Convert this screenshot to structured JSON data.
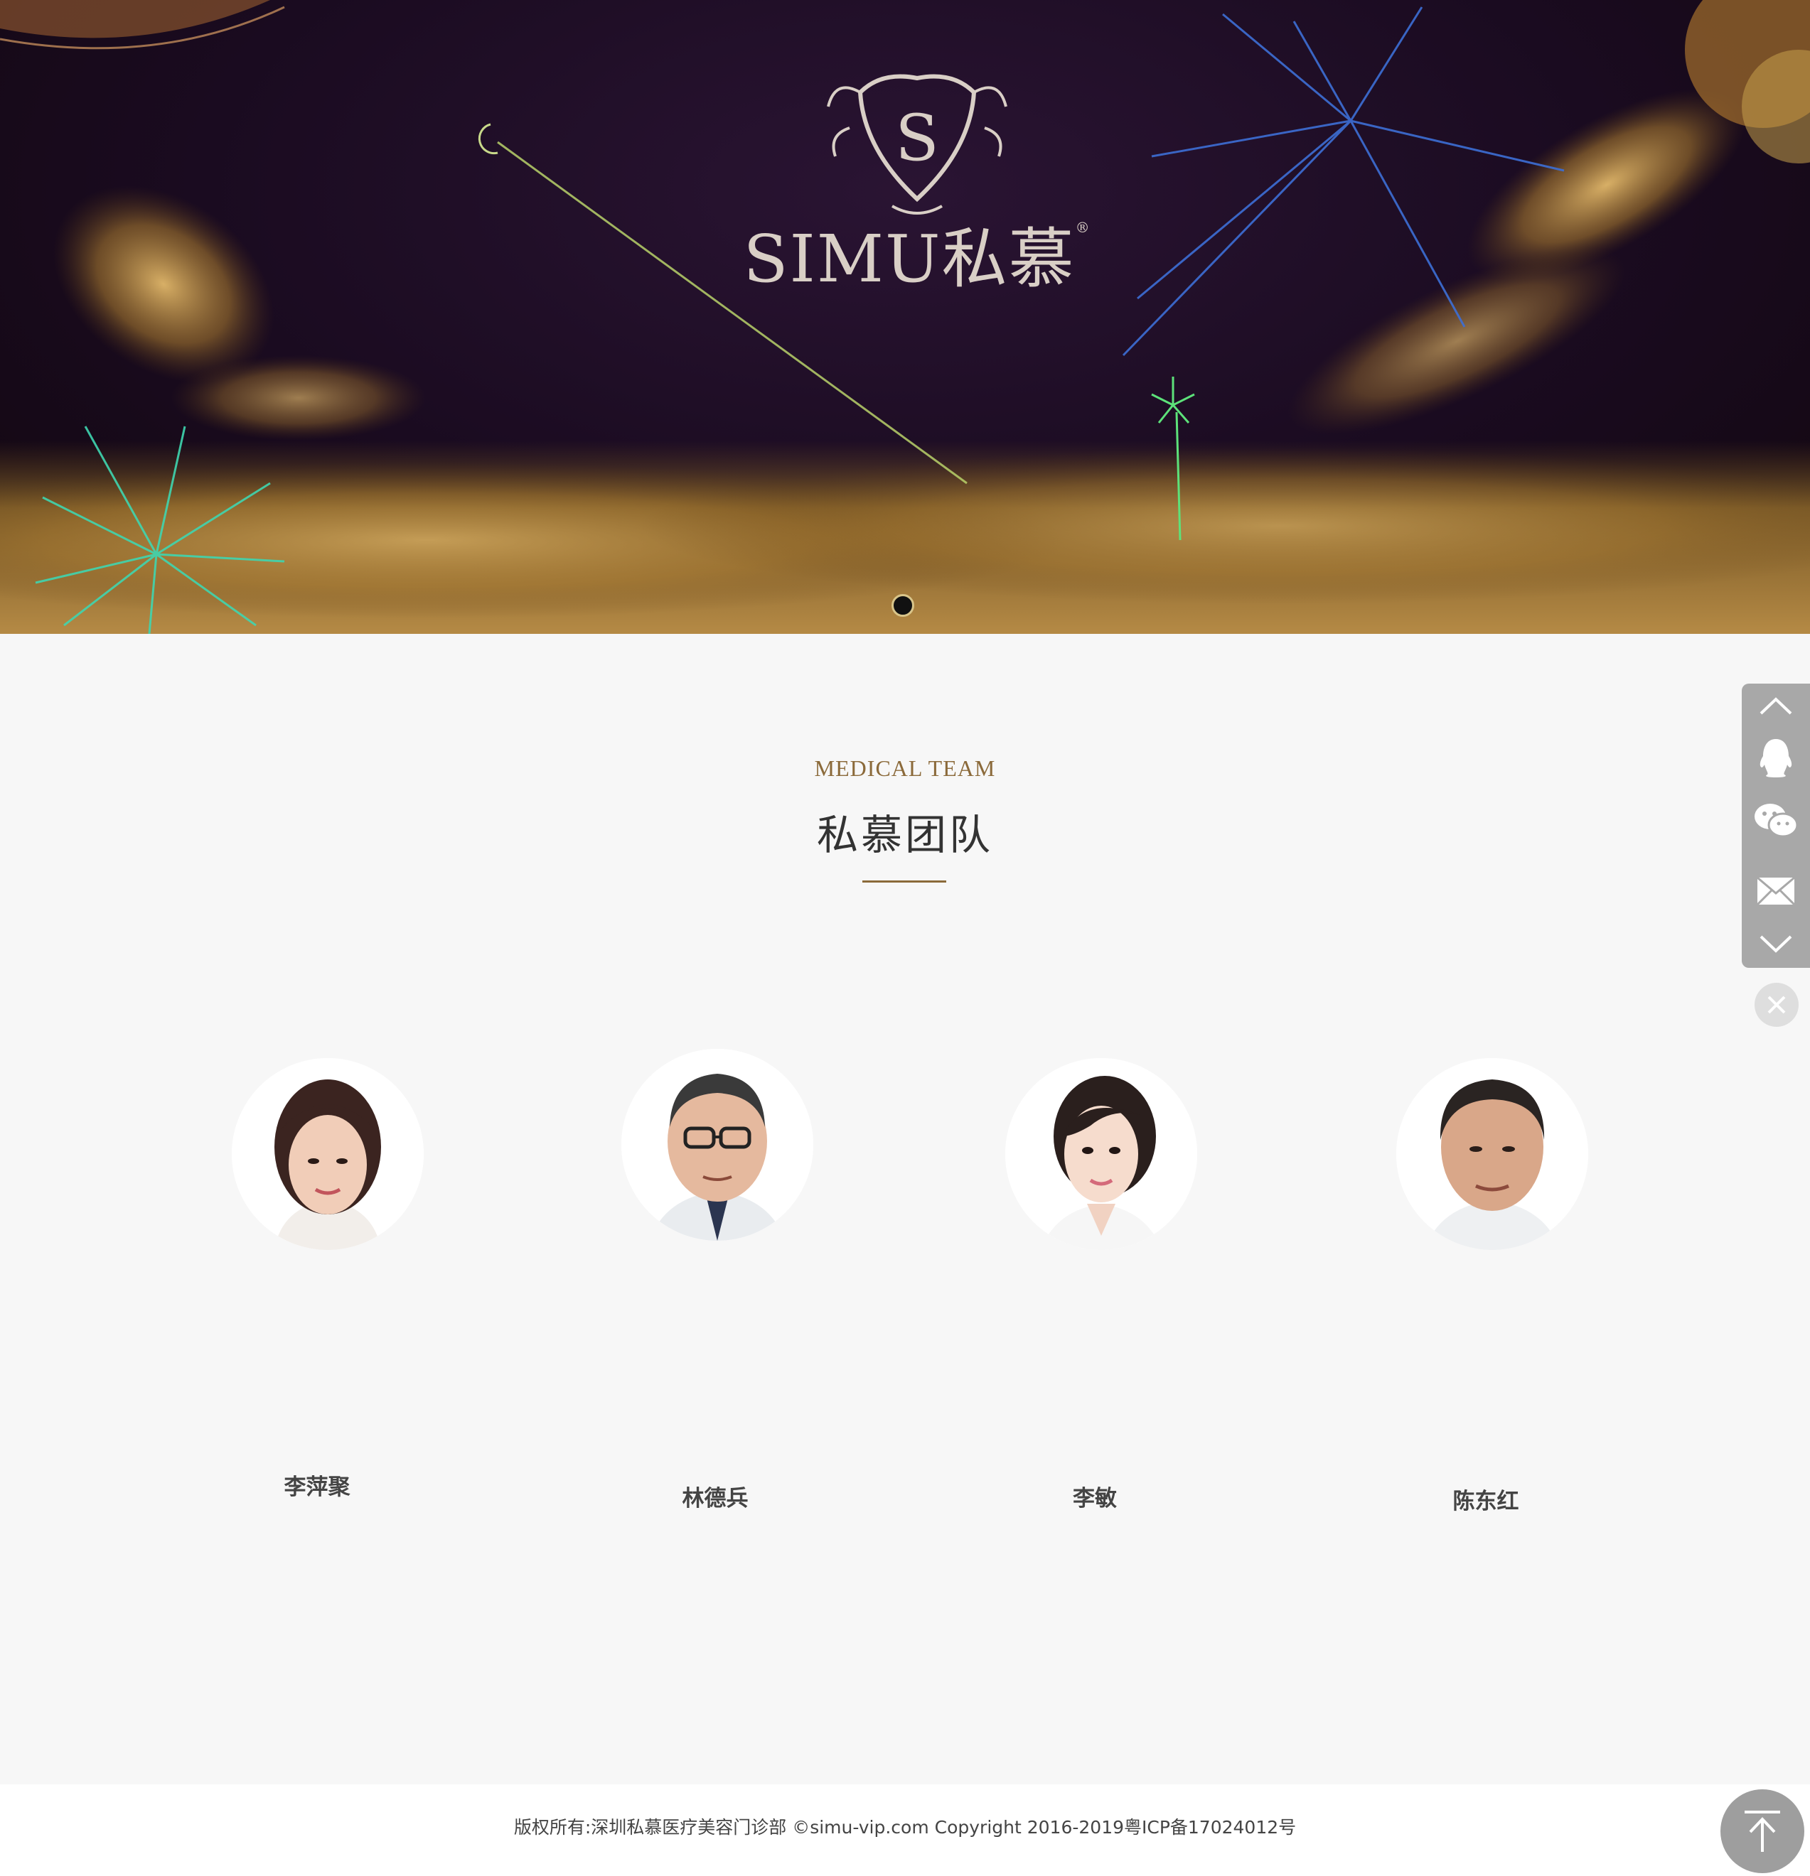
{
  "banner": {
    "brand_latin": "SIMU",
    "brand_cn": "私慕",
    "registered_mark": "®",
    "slide_count": 1,
    "active_slide": 1
  },
  "team_section": {
    "subtitle": "MEDICAL TEAM",
    "title": "私慕团队",
    "accent_color": "#8b6a3a"
  },
  "doctors": [
    {
      "name": "李萍聚"
    },
    {
      "name": "林德兵"
    },
    {
      "name": "李敏"
    },
    {
      "name": "陈东红"
    }
  ],
  "sidebar": {
    "items": [
      "chevron-up-icon",
      "qq-icon",
      "wechat-icon",
      "mail-icon",
      "chevron-down-icon"
    ],
    "close": "close-icon"
  },
  "footer": {
    "copyright": "版权所有:深圳私慕医疗美容门诊部 ©simu-vip.com Copyright 2016-2019粤ICP备17024012号",
    "to_top": "arrow-up-to-top-icon"
  }
}
